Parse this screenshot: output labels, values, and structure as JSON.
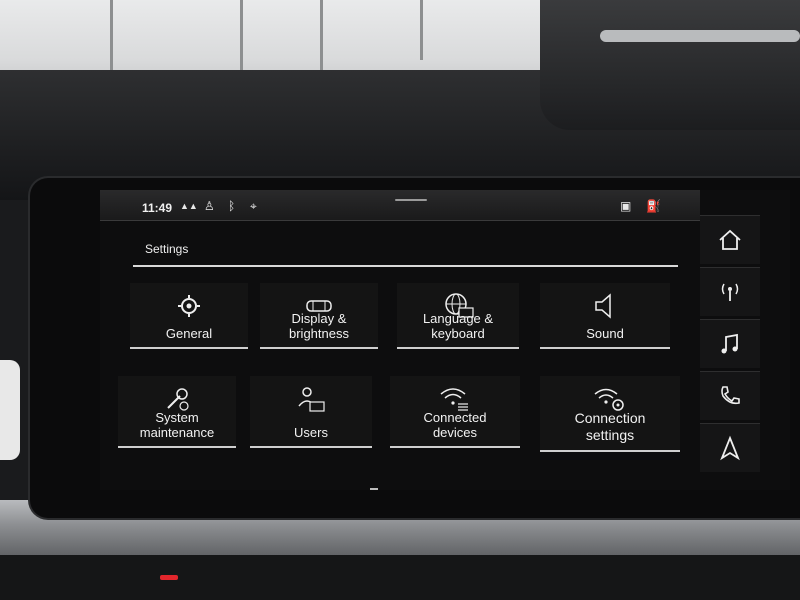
{
  "status_bar": {
    "time": "11:49",
    "icons": [
      "lte-signal-icon",
      "person-icon",
      "bluetooth-icon",
      "location-icon",
      "package-icon",
      "fuel-icon"
    ]
  },
  "settings": {
    "title": "Settings"
  },
  "tiles": [
    {
      "label": "General",
      "icon": "gear-icon"
    },
    {
      "label": "Display & brightness",
      "icon": "car-display-icon"
    },
    {
      "label": "Language & keyboard",
      "icon": "globe-keyboard-icon"
    },
    {
      "label": "Sound",
      "icon": "speaker-icon"
    },
    {
      "label": "System maintenance",
      "icon": "wrench-icon"
    },
    {
      "label": "Users",
      "icon": "user-card-icon"
    },
    {
      "label": "Connected devices",
      "icon": "wifi-list-icon"
    },
    {
      "label": "Connection settings",
      "icon": "wifi-gear-icon"
    }
  ],
  "nav": [
    "home-icon",
    "radio-antenna-icon",
    "music-note-icon",
    "phone-icon",
    "navigation-arrow-icon"
  ],
  "pagination": {
    "pages": 2,
    "current": 1
  },
  "colors": {
    "screen_bg": "#0d0d0e",
    "text": "#f2f2f2",
    "underline": "#cfcfcf"
  }
}
